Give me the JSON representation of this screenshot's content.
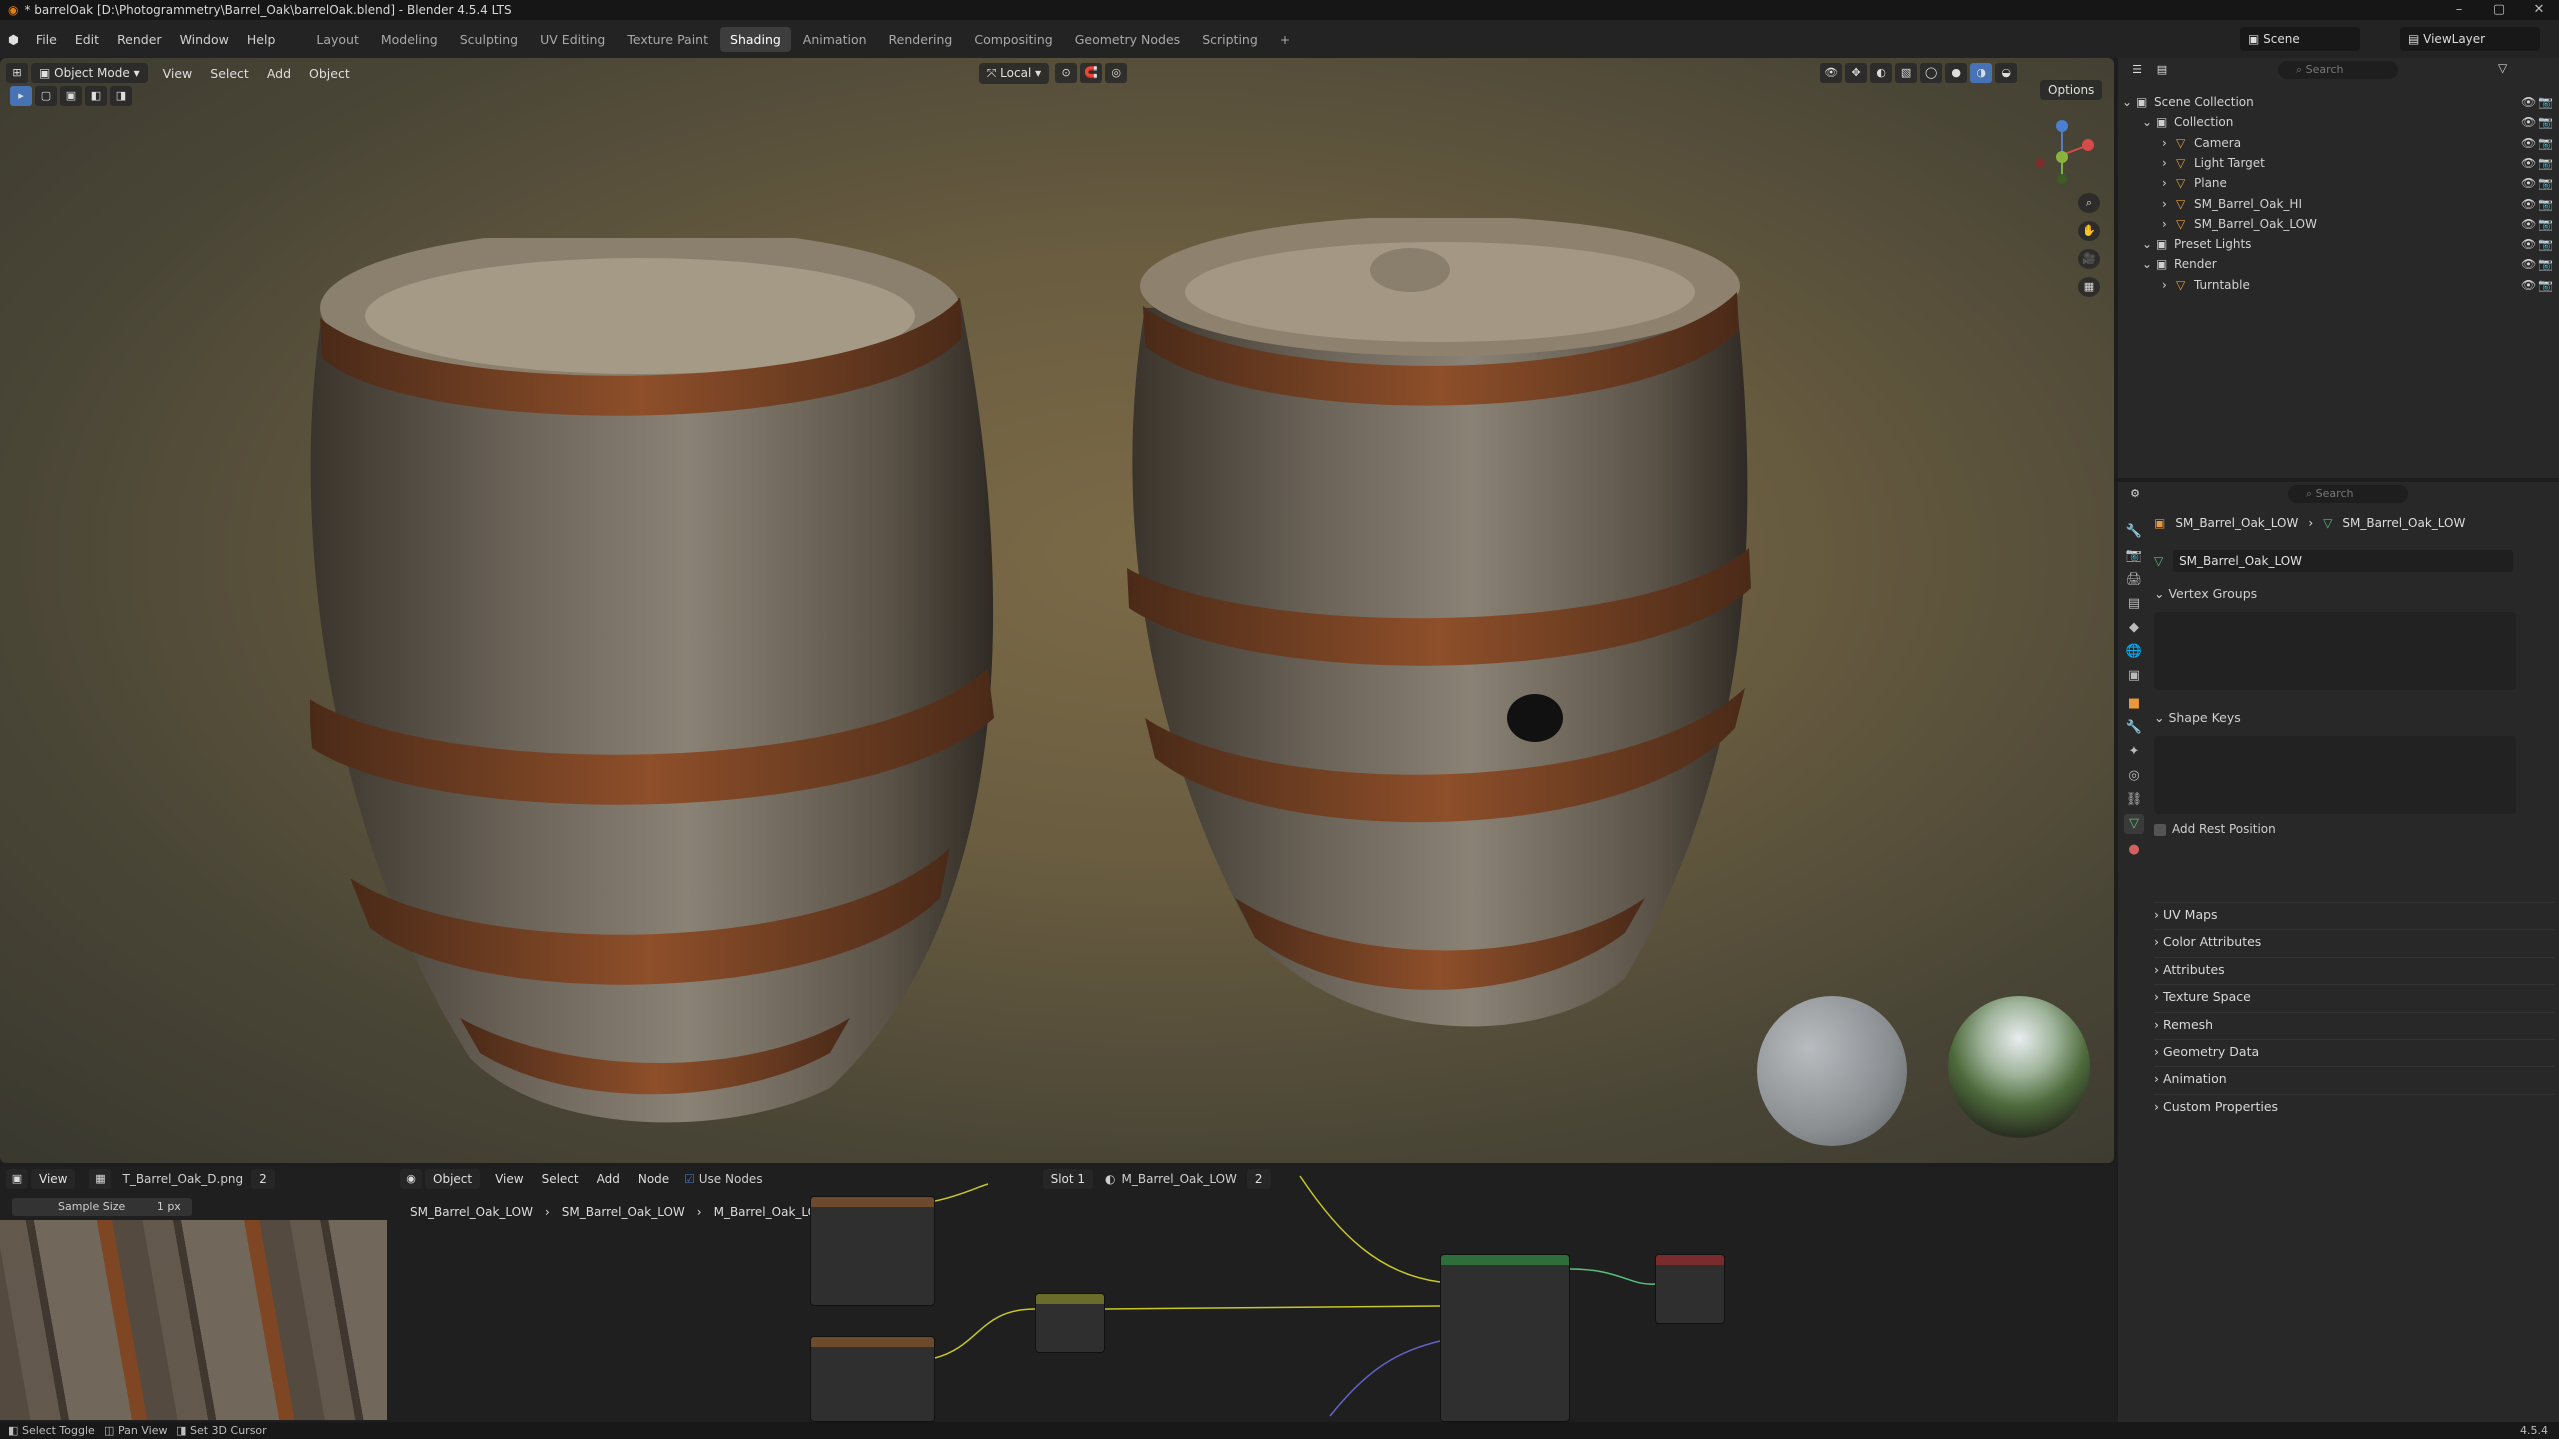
{
  "window": {
    "title": "* barrelOak [D:\\Photogrammetry\\Barrel_Oak\\barrelOak.blend] - Blender 4.5.4 LTS"
  },
  "menus": [
    "File",
    "Edit",
    "Render",
    "Window",
    "Help"
  ],
  "workspaces": [
    "Layout",
    "Modeling",
    "Sculpting",
    "UV Editing",
    "Texture Paint",
    "Shading",
    "Animation",
    "Rendering",
    "Compositing",
    "Geometry Nodes",
    "Scripting",
    "+"
  ],
  "active_workspace": "Shading",
  "scene": {
    "name": "Scene",
    "viewlayer": "ViewLayer"
  },
  "viewport": {
    "mode": "Object Mode",
    "menus": [
      "View",
      "Select",
      "Add",
      "Object"
    ],
    "transform": "Local",
    "options_label": "Options"
  },
  "outliner": {
    "search_placeholder": "Search",
    "items": [
      {
        "label": "Scene Collection",
        "indent": 0
      },
      {
        "label": "Collection",
        "indent": 1
      },
      {
        "label": "Camera",
        "indent": 2
      },
      {
        "label": "Light Target",
        "indent": 2
      },
      {
        "label": "Plane",
        "indent": 2
      },
      {
        "label": "SM_Barrel_Oak_HI",
        "indent": 2
      },
      {
        "label": "SM_Barrel_Oak_LOW",
        "indent": 2
      },
      {
        "label": "Preset Lights",
        "indent": 1
      },
      {
        "label": "Render",
        "indent": 1
      },
      {
        "label": "Turntable",
        "indent": 2
      }
    ]
  },
  "properties": {
    "search_placeholder": "Search",
    "breadcrumb": [
      "SM_Barrel_Oak_LOW",
      "SM_Barrel_Oak_LOW"
    ],
    "mesh_name": "SM_Barrel_Oak_LOW",
    "vertex_groups": "Vertex Groups",
    "shape_keys": "Shape Keys",
    "add_rest_position": "Add Rest Position",
    "panels": [
      "UV Maps",
      "Color Attributes",
      "Attributes",
      "Texture Space",
      "Remesh",
      "Geometry Data",
      "Animation",
      "Custom Properties"
    ]
  },
  "image_editor": {
    "view": "View",
    "image_name": "T_Barrel_Oak_D.png",
    "users": "2",
    "sample_size_label": "Sample Size",
    "sample_size_value": "1 px"
  },
  "node_editor": {
    "object": "Object",
    "menus": [
      "View",
      "Select",
      "Add",
      "Node"
    ],
    "use_nodes": "Use Nodes",
    "slot": "Slot 1",
    "material": "M_Barrel_Oak_LOW",
    "material_users": "2",
    "breadcrumb": [
      "SM_Barrel_Oak_LOW",
      "SM_Barrel_Oak_LOW",
      "M_Barrel_Oak_LOW"
    ]
  },
  "status": {
    "items": [
      "Select Toggle",
      "Pan View",
      "Set 3D Cursor"
    ],
    "version": "4.5.4"
  },
  "colors": {
    "accent": "#4772b3",
    "active_ws": "#3d3d3d",
    "panel": "#282828"
  }
}
